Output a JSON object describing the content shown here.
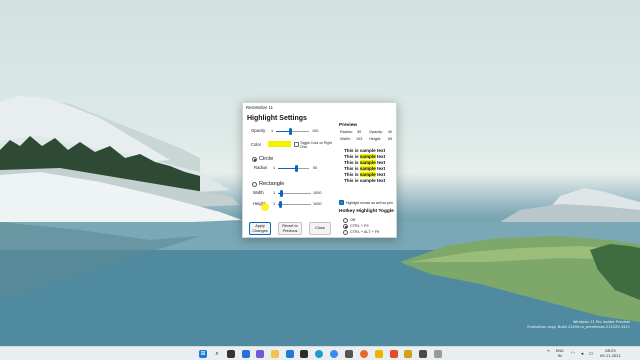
{
  "window": {
    "title": "ResHtmlize 11"
  },
  "highlight": {
    "heading": "Highlight Settings",
    "opacity_label": "Opacity",
    "opacity_min": "1",
    "opacity_max": "100",
    "opacity_value_fraction": 0.45,
    "color_label": "Color",
    "color_value": "#f2f200",
    "toggle_color_label": "Toggle Color on Right Click",
    "circle_label": "Circle",
    "radius_label": "Radius",
    "radius_min": "1",
    "radius_max": "50",
    "radius_value_fraction": 0.6,
    "rectangle_label": "Rectangle",
    "width_label": "Width",
    "width_min": "1",
    "width_max": "1000",
    "width_value_fraction": 0.1,
    "height_label": "Height",
    "height_min": "1",
    "height_max": "1000",
    "height_value_fraction": 0.07,
    "selected_shape": "circle"
  },
  "preview": {
    "heading": "Preview",
    "radius_label": "Radius:",
    "radius_value": "30",
    "opacity_label": "Opacity:",
    "opacity_value": "40",
    "width_label": "Width:",
    "width_value": "103",
    "height_label": "Height:",
    "height_value": "69",
    "sample_lines": [
      "This is sample text",
      "This is sample text",
      "This is sample text",
      "This is sample text",
      "This is sample text",
      "This is sample text"
    ],
    "highlight_mouse_label": "Highlight mouse as well as pen"
  },
  "hotkey": {
    "heading": "Hotkey Highlight Toggle",
    "options": [
      "Off",
      "CTRL + F9",
      "CTRL + ALT + F9"
    ],
    "selected_index": 1
  },
  "buttons": {
    "apply": "Apply Changes",
    "revert": "Revert to Previous",
    "close": "Close"
  },
  "watermark": {
    "line1": "Windows 11 Pro Insider Preview",
    "line2": "Evaluation copy. Build 22494.rs_prerelease.211029-1421"
  },
  "taskbar": {
    "lang_line1": "ENG",
    "lang_line2": "IN",
    "time": "08:29",
    "date": "09-11-2021"
  },
  "colors": {
    "accent": "#0a66c2",
    "highlight_yellow": "#f4f400"
  }
}
